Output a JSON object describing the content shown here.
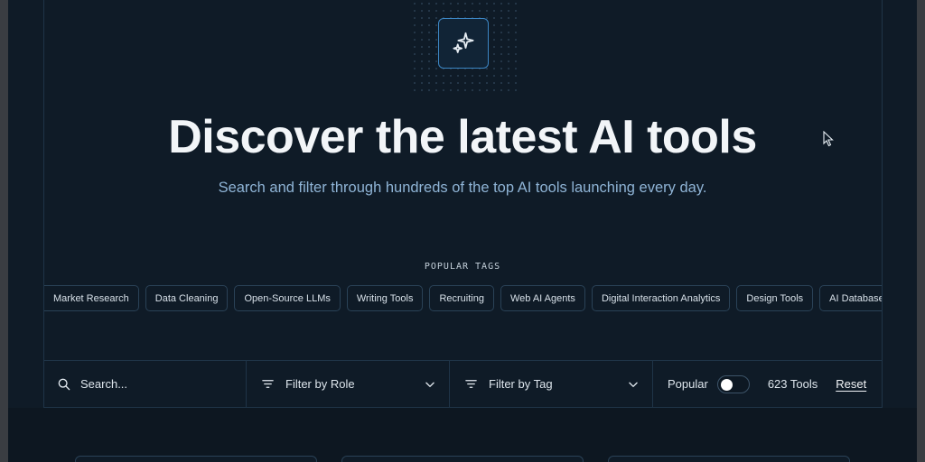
{
  "hero": {
    "title": "Discover the latest AI tools",
    "subtitle": "Search and filter through hundreds of the top AI tools launching every day.",
    "icon": "sparkles-icon"
  },
  "tags": {
    "label": "POPULAR TAGS",
    "items": [
      "Market Research",
      "Data Cleaning",
      "Open-Source LLMs",
      "Writing Tools",
      "Recruiting",
      "Web AI Agents",
      "Digital Interaction Analytics",
      "Design Tools",
      "AI Databases"
    ]
  },
  "filters": {
    "search_placeholder": "Search...",
    "role_label": "Filter by Role",
    "tag_label": "Filter by Tag",
    "popular_label": "Popular",
    "count_label": "623 Tools",
    "reset_label": "Reset"
  },
  "colors": {
    "background": "#0f1b27",
    "accent": "#3c86c4",
    "subtitle": "#8fb4d6"
  }
}
